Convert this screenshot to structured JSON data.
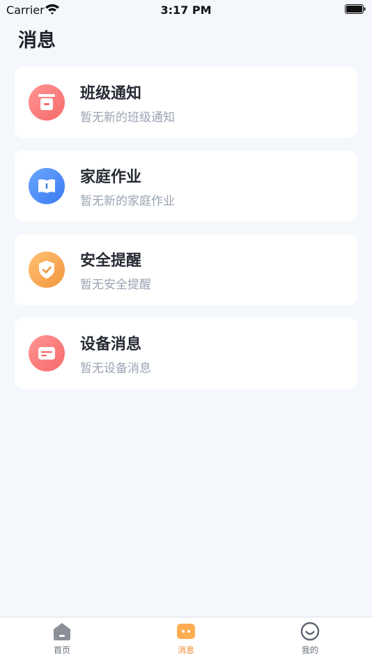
{
  "status_bar": {
    "carrier": "Carrier",
    "time": "3:17 PM"
  },
  "page": {
    "title": "消息"
  },
  "messages": [
    {
      "title": "班级通知",
      "subtitle": "暂无新的班级通知",
      "icon": "class-notice-icon",
      "color": "#f66a6a"
    },
    {
      "title": "家庭作业",
      "subtitle": "暂无新的家庭作业",
      "icon": "homework-book-icon",
      "color": "#3a7af0"
    },
    {
      "title": "安全提醒",
      "subtitle": "暂无安全提醒",
      "icon": "shield-check-icon",
      "color": "#f2953e"
    },
    {
      "title": "设备消息",
      "subtitle": "暂无设备消息",
      "icon": "device-card-icon",
      "color": "#f66a6a"
    }
  ],
  "tabs": [
    {
      "label": "首页",
      "icon": "home-icon",
      "active": false
    },
    {
      "label": "消息",
      "icon": "message-icon",
      "active": true
    },
    {
      "label": "我的",
      "icon": "smile-icon",
      "active": false
    }
  ],
  "colors": {
    "accent": "#f08a2c",
    "background": "#f4f7fc"
  }
}
